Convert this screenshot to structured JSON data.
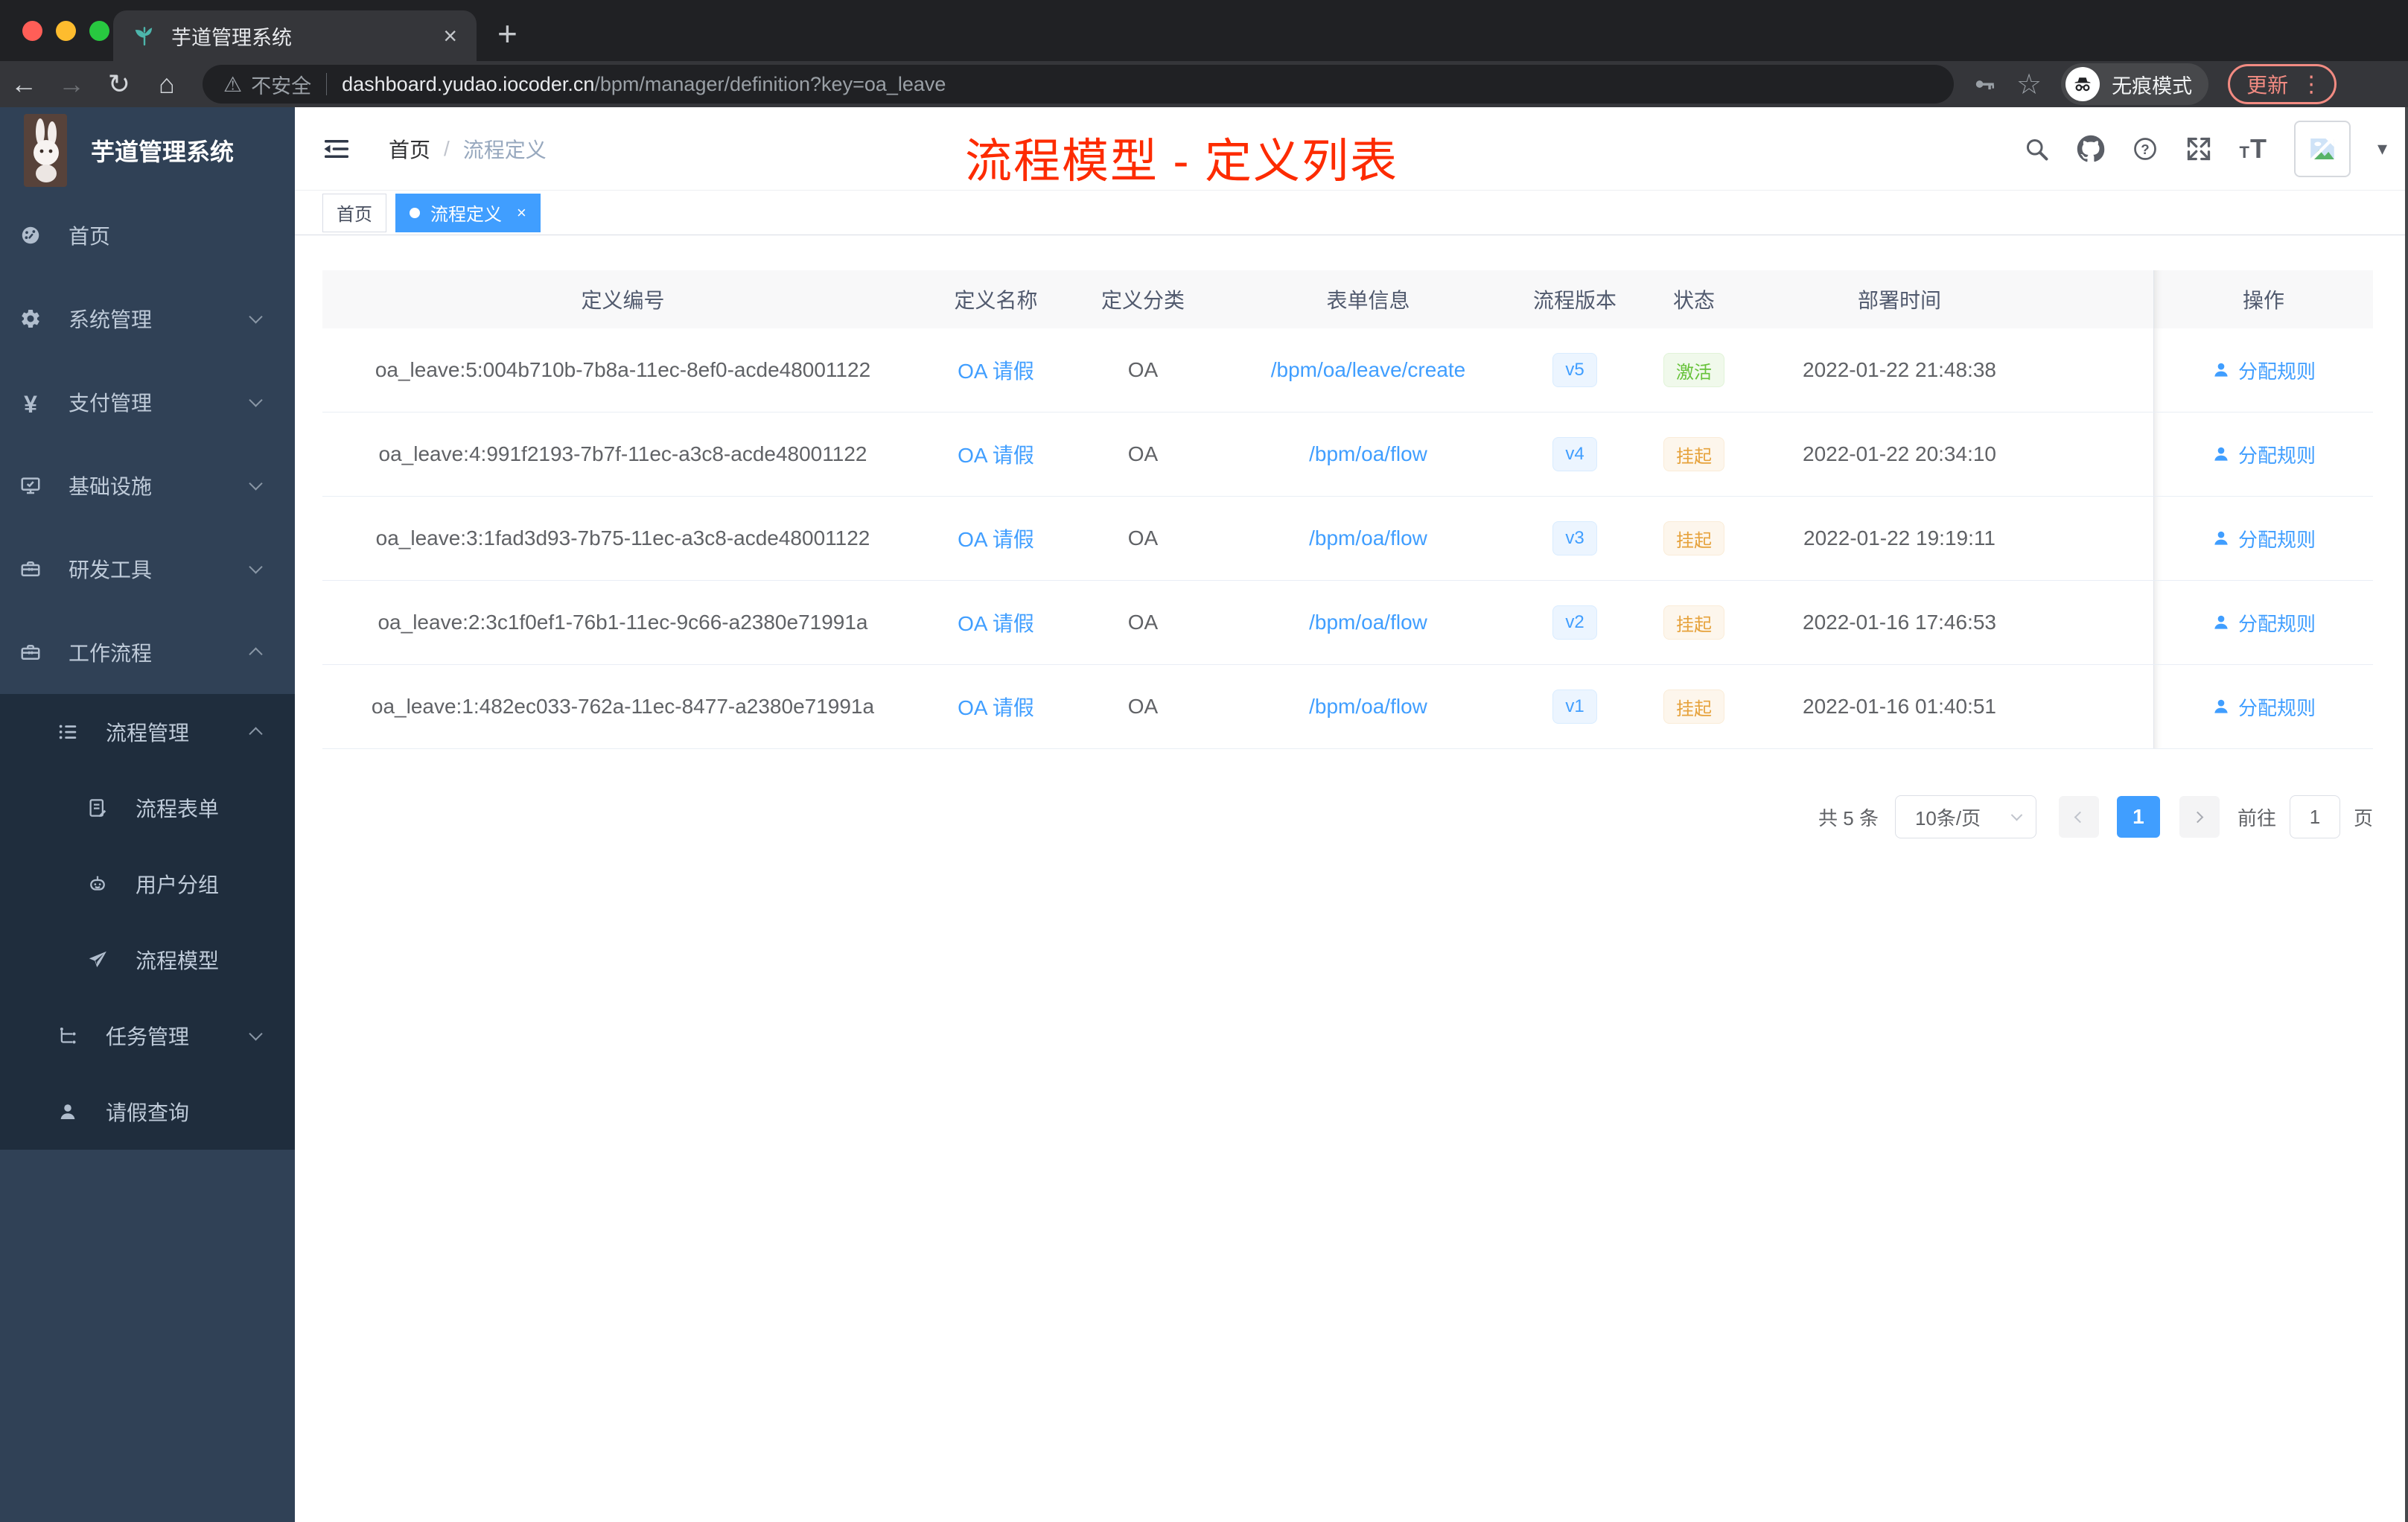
{
  "colors": {
    "accent": "#409eff",
    "success": "#67c23a",
    "warning": "#e6a23c",
    "annotation_red": "#fd2b00",
    "sidebar_bg": "#304156",
    "submenu_bg": "#1f2d3d",
    "chrome_bg": "#202124",
    "toolbar_bg": "#35363a"
  },
  "browser": {
    "tab_title": "芋道管理系统",
    "tab_close": "×",
    "new_tab": "+",
    "nav": {
      "back": "←",
      "forward": "→",
      "reload": "↻",
      "home": "⌂"
    },
    "address": {
      "warning_icon": "⚠",
      "warning_label": "不安全",
      "host": "dashboard.yudao.iocoder.cn",
      "path": "/bpm/manager/definition?key=oa_leave"
    },
    "incognito_label": "无痕模式",
    "update_label": "更新",
    "kebab": "⋮",
    "star": "☆"
  },
  "sidebar": {
    "logo_title": "芋道管理系统",
    "items": [
      {
        "label": "首页"
      },
      {
        "label": "系统管理"
      },
      {
        "label": "支付管理"
      },
      {
        "label": "基础设施"
      },
      {
        "label": "研发工具"
      },
      {
        "label": "工作流程"
      },
      {
        "label": "流程管理"
      },
      {
        "label": "流程表单"
      },
      {
        "label": "用户分组"
      },
      {
        "label": "流程模型"
      },
      {
        "label": "任务管理"
      },
      {
        "label": "请假查询"
      }
    ]
  },
  "header": {
    "breadcrumb_home": "首页",
    "breadcrumb_sep": "/",
    "breadcrumb_current": "流程定义",
    "caret": "▾"
  },
  "annotation": "流程模型 - 定义列表",
  "tags": {
    "home": "首页",
    "active": "流程定义",
    "close": "×"
  },
  "table": {
    "headers": [
      "定义编号",
      "定义名称",
      "定义分类",
      "表单信息",
      "流程版本",
      "状态",
      "部署时间",
      "操作"
    ],
    "rows": [
      {
        "id": "oa_leave:5:004b710b-7b8a-11ec-8ef0-acde48001122",
        "name": "OA 请假",
        "category": "OA",
        "form": "/bpm/oa/leave/create",
        "version": "v5",
        "status": "激活",
        "time": "2022-01-22 21:48:38",
        "action": "分配规则"
      },
      {
        "id": "oa_leave:4:991f2193-7b7f-11ec-a3c8-acde48001122",
        "name": "OA 请假",
        "category": "OA",
        "form": "/bpm/oa/flow",
        "version": "v4",
        "status": "挂起",
        "time": "2022-01-22 20:34:10",
        "action": "分配规则"
      },
      {
        "id": "oa_leave:3:1fad3d93-7b75-11ec-a3c8-acde48001122",
        "name": "OA 请假",
        "category": "OA",
        "form": "/bpm/oa/flow",
        "version": "v3",
        "status": "挂起",
        "time": "2022-01-22 19:19:11",
        "action": "分配规则"
      },
      {
        "id": "oa_leave:2:3c1f0ef1-76b1-11ec-9c66-a2380e71991a",
        "name": "OA 请假",
        "category": "OA",
        "form": "/bpm/oa/flow",
        "version": "v2",
        "status": "挂起",
        "time": "2022-01-16 17:46:53",
        "action": "分配规则"
      },
      {
        "id": "oa_leave:1:482ec033-762a-11ec-8477-a2380e71991a",
        "name": "OA 请假",
        "category": "OA",
        "form": "/bpm/oa/flow",
        "version": "v1",
        "status": "挂起",
        "time": "2022-01-16 01:40:51",
        "action": "分配规则"
      }
    ]
  },
  "pagination": {
    "total": "共 5 条",
    "page_size": "10条/页",
    "current": "1",
    "goto_label": "前往",
    "goto_value": "1",
    "page_suffix": "页"
  }
}
